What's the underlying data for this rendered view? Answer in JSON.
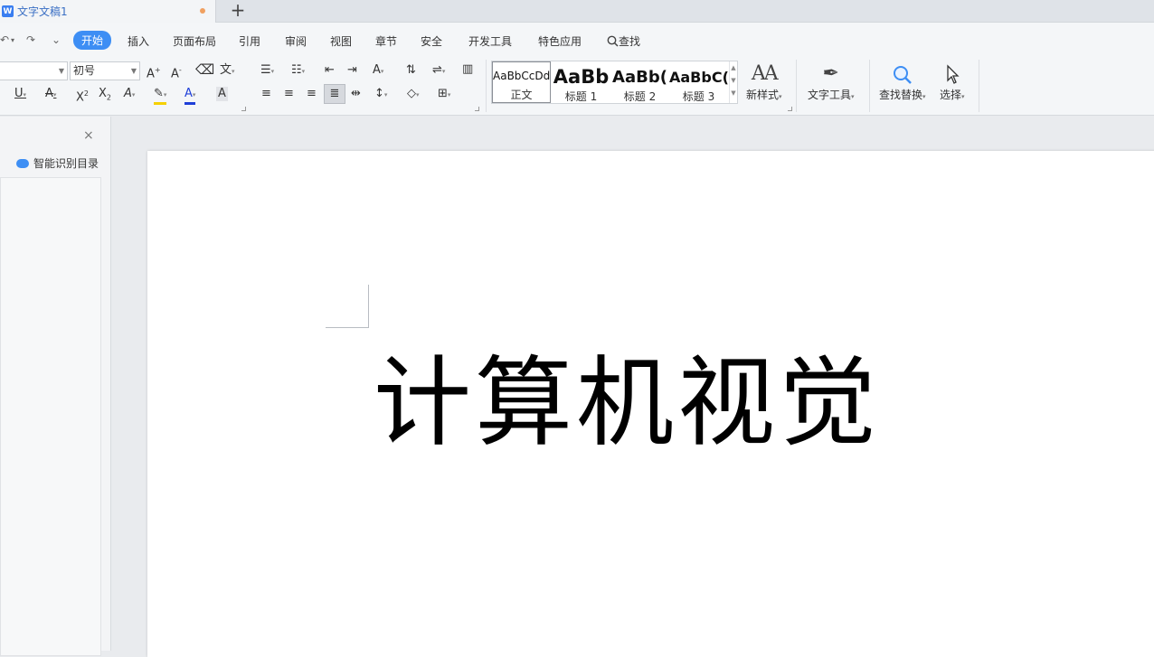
{
  "tab": {
    "title": "文字文稿1",
    "new_tab": "+"
  },
  "quick_access": {
    "undo": "↶",
    "redo": "↷",
    "more": "⌄"
  },
  "menu": {
    "items": [
      "开始",
      "插入",
      "页面布局",
      "引用",
      "审阅",
      "视图",
      "章节",
      "安全",
      "开发工具",
      "特色应用"
    ],
    "search": "查找"
  },
  "font": {
    "size": "初号"
  },
  "styles": [
    {
      "sample": "AaBbCcDd",
      "label": "正文"
    },
    {
      "sample": "AaBb",
      "label": "标题 1"
    },
    {
      "sample": "AaBb(",
      "label": "标题 2"
    },
    {
      "sample": "AaBbC(",
      "label": "标题 3"
    }
  ],
  "tools": {
    "new_style": "新样式",
    "text_tools": "文字工具",
    "find_replace": "查找替换",
    "select": "选择"
  },
  "pane": {
    "toc_label": "智能识别目录",
    "close": "×"
  },
  "document": {
    "title_text": "计算机视觉"
  },
  "colors": {
    "accent": "#3d8ef4",
    "highlight": "#f5d000",
    "font_color": "#1f3fd8"
  }
}
